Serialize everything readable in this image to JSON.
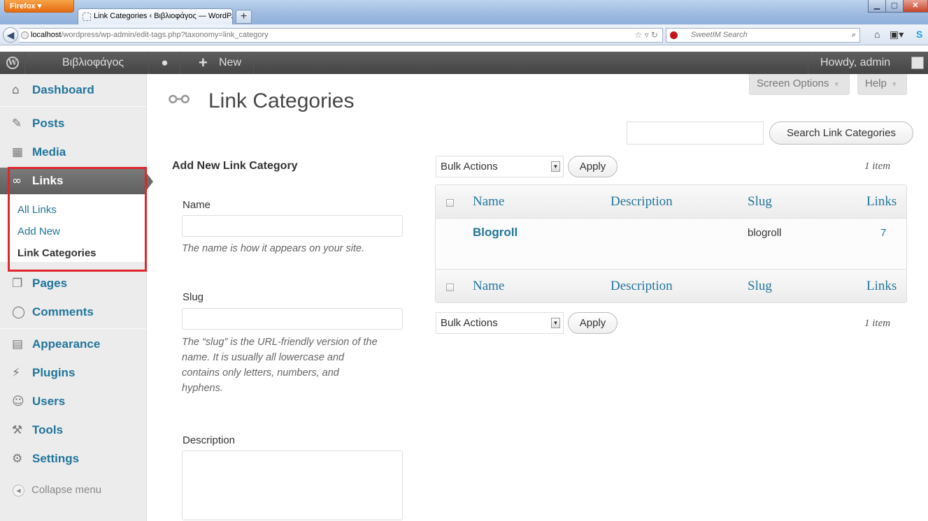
{
  "browser": {
    "menu_button": "Firefox",
    "tab_title": "Link Categories ‹ Βιβλιοφάγος — WordP...",
    "new_tab": "+",
    "url_host": "localhost",
    "url_path": "/wordpress/wp-admin/edit-tags.php?taxonomy=link_category",
    "search_engine_placeholder": "SweetIM Search"
  },
  "adminbar": {
    "site_name": "Βιβλιοφάγος",
    "new_label": "New",
    "howdy": "Howdy, admin"
  },
  "sidebar": {
    "items": [
      {
        "label": "Dashboard",
        "icon": "dashboard-icon"
      },
      {
        "label": "Posts",
        "icon": "posts-icon"
      },
      {
        "label": "Media",
        "icon": "media-icon"
      },
      {
        "label": "Links",
        "icon": "links-icon"
      },
      {
        "label": "Pages",
        "icon": "pages-icon"
      },
      {
        "label": "Comments",
        "icon": "comments-icon"
      },
      {
        "label": "Appearance",
        "icon": "appearance-icon"
      },
      {
        "label": "Plugins",
        "icon": "plugins-icon"
      },
      {
        "label": "Users",
        "icon": "users-icon"
      },
      {
        "label": "Tools",
        "icon": "tools-icon"
      },
      {
        "label": "Settings",
        "icon": "settings-icon"
      }
    ],
    "submenu": [
      "All Links",
      "Add New",
      "Link Categories"
    ],
    "collapse": "Collapse menu"
  },
  "page": {
    "title": "Link Categories",
    "screen_options": "Screen Options",
    "help": "Help",
    "search_button": "Search Link Categories"
  },
  "form": {
    "heading": "Add New Link Category",
    "name_label": "Name",
    "name_help": "The name is how it appears on your site.",
    "slug_label": "Slug",
    "slug_help": [
      "The “slug” is the URL-friendly version of the",
      "name. It is usually all lowercase and",
      "contains only letters, numbers, and",
      "hyphens."
    ],
    "description_label": "Description"
  },
  "table": {
    "bulk_actions": "Bulk Actions",
    "apply": "Apply",
    "count": "1 item",
    "columns": [
      "Name",
      "Description",
      "Slug",
      "Links"
    ],
    "rows": [
      {
        "name": "Blogroll",
        "description": "",
        "slug": "blogroll",
        "links": "7"
      }
    ]
  }
}
